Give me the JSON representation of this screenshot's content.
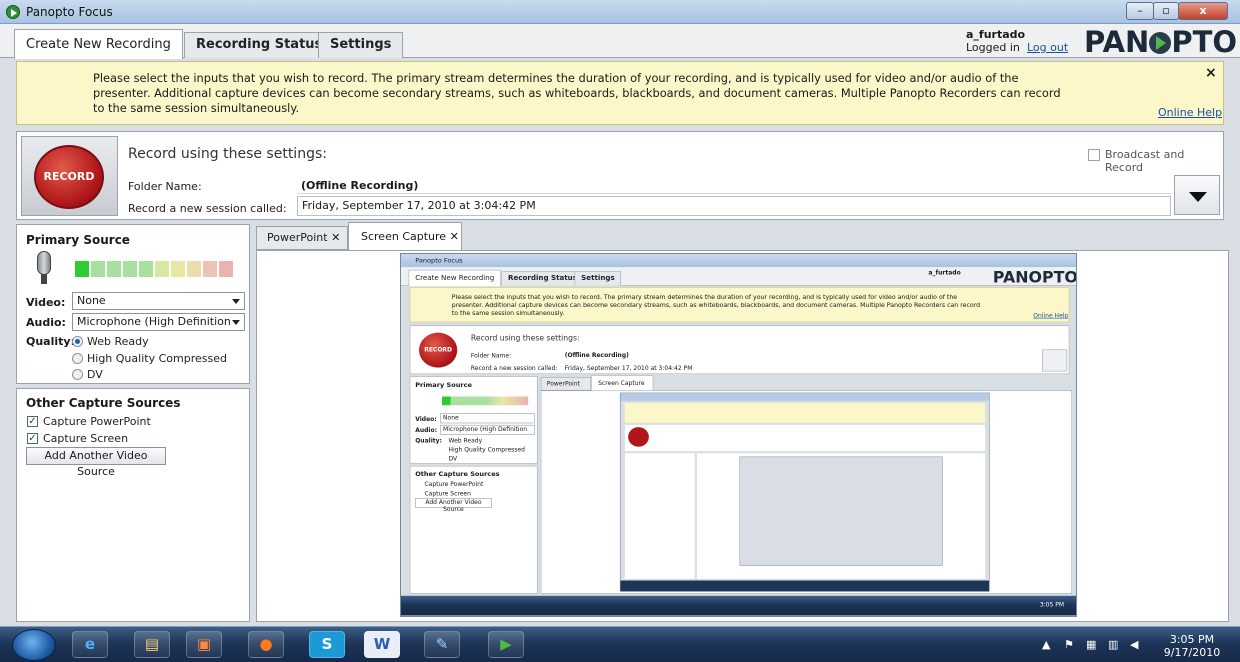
{
  "window": {
    "title": "Panopto Focus",
    "min": "–",
    "max": "▫",
    "close": "x"
  },
  "tabs": {
    "create": "Create New Recording",
    "status": "Recording Status",
    "settings": "Settings"
  },
  "user": {
    "name": "a_furtado",
    "logged_in": "Logged in",
    "logout": "Log out"
  },
  "logo": {
    "pre": "PAN",
    "post": "PTO"
  },
  "info": {
    "text": "Please select the inputs that you wish to record.  The primary stream determines the duration of your recording, and is typically used for video and/or audio of the presenter.  Additional capture devices can become secondary streams, such as whiteboards, blackboards, and document cameras.  Multiple Panopto Recorders can record to the same session simultaneously.",
    "close": "×",
    "help": "Online Help"
  },
  "record": {
    "button": "RECORD",
    "heading": "Record using these settings:",
    "broadcast": "Broadcast and Record",
    "folder_label": "Folder Name:",
    "folder_value": "(Offline Recording)",
    "session_label": "Record a new session called:",
    "session_value": "Friday, September 17, 2010 at 3:04:42 PM"
  },
  "primary": {
    "title": "Primary Source",
    "video_label": "Video:",
    "video_value": "None",
    "audio_label": "Audio:",
    "audio_value": "Microphone (High Definition",
    "quality_label": "Quality:",
    "quality_options": [
      "Web Ready",
      "High Quality Compressed",
      "DV"
    ],
    "quality_selected": "Web Ready"
  },
  "other": {
    "title": "Other Capture Sources",
    "items": [
      "Capture PowerPoint",
      "Capture Screen"
    ],
    "add": "Add Another Video Source"
  },
  "preview_tabs": {
    "pp": "PowerPoint",
    "sc": "Screen Capture",
    "close": "✕"
  },
  "colors": {
    "accent": "#1a4fa3",
    "record": "#b0161a",
    "banner": "#fbf7c9"
  },
  "taskbar": {
    "time": "3:05 PM",
    "date": "9/17/2010",
    "apps": [
      "ie-icon",
      "explorer-icon",
      "media-icon",
      "firefox-icon",
      "skype-icon",
      "word-icon",
      "paint-icon",
      "panopto-icon"
    ],
    "skype_letter": "S",
    "word_letter": "W"
  }
}
